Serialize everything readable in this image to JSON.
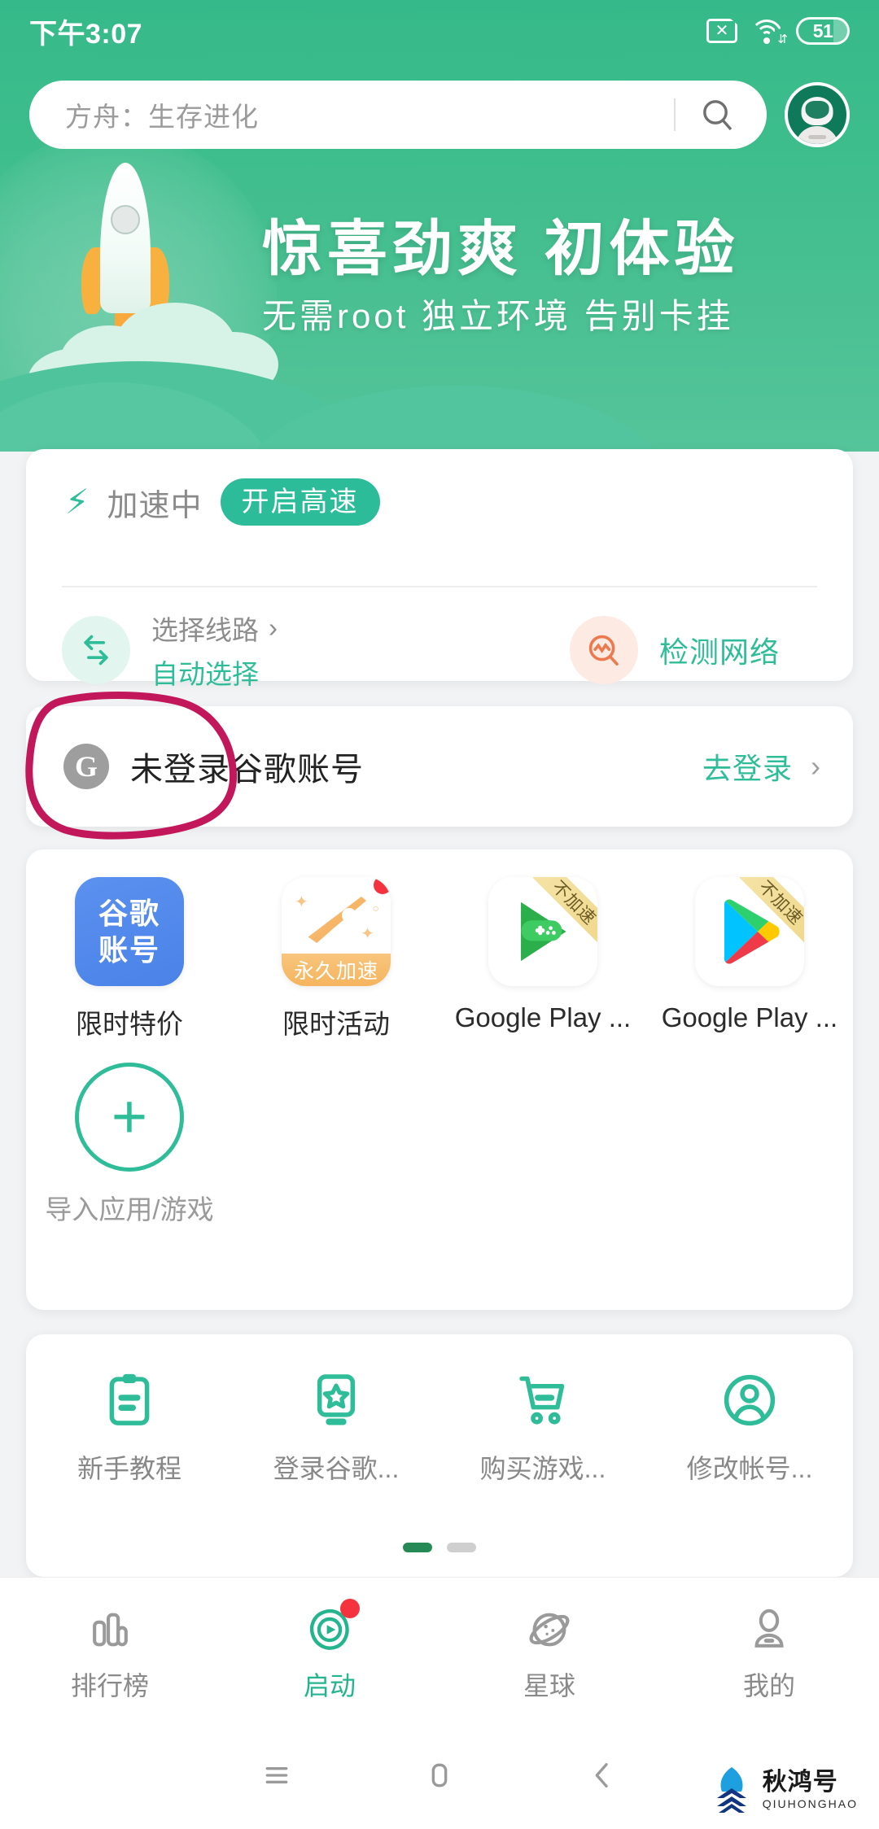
{
  "status_bar": {
    "time": "下午3:07",
    "sim_icon": "sim-card-x-icon",
    "wifi_icon": "wifi-icon",
    "battery_level": "51"
  },
  "search": {
    "placeholder": "方舟：生存进化",
    "search_icon": "search-icon",
    "avatar": "astronaut-avatar"
  },
  "hero": {
    "title": "惊喜劲爽  初体验",
    "subtitle": "无需root  独立环境  告别卡挂",
    "illustration": "rocket-launch-illustration"
  },
  "accelerate_card": {
    "bolt_icon": "lightning-bolt-icon",
    "status_label": "加速中",
    "speed_badge": "开启高速",
    "route": {
      "icon": "swap-arrows-icon",
      "title": "选择线路",
      "chevron": "chevron-right-icon",
      "value": "自动选择"
    },
    "network_check": {
      "icon": "network-pulse-search-icon",
      "label": "检测网络"
    }
  },
  "google_card": {
    "avatar_letter": "G",
    "title": "未登录谷歌账号",
    "action": "去登录",
    "chevron": "chevron-right-icon"
  },
  "apps": [
    {
      "label": "限时特价",
      "icon": "google-account-icon",
      "icon_text_line1": "谷歌",
      "icon_text_line2": "账号",
      "ribbon": "",
      "badge": false
    },
    {
      "label": "限时活动",
      "icon": "rocket-promo-icon",
      "icon_caption": "永久加速",
      "ribbon": "",
      "badge": true
    },
    {
      "label": "Google Play ...",
      "icon": "google-play-games-icon",
      "ribbon": "不加速",
      "badge": false
    },
    {
      "label": "Google Play ...",
      "icon": "google-play-store-icon",
      "ribbon": "不加速",
      "badge": false
    }
  ],
  "import_tile": {
    "icon": "plus-circle-icon",
    "label": "导入应用/游戏"
  },
  "shortcuts": [
    {
      "label": "新手教程",
      "icon": "clipboard-icon"
    },
    {
      "label": "登录谷歌...",
      "icon": "phone-star-icon"
    },
    {
      "label": "购买游戏...",
      "icon": "shopping-cart-icon"
    },
    {
      "label": "修改帐号...",
      "icon": "person-circle-icon"
    }
  ],
  "pager": {
    "total": 2,
    "active_index": 0
  },
  "bottom_nav": [
    {
      "label": "排行榜",
      "icon": "bar-chart-icon",
      "active": false,
      "badge": false
    },
    {
      "label": "启动",
      "icon": "play-leaf-icon",
      "active": true,
      "badge": true
    },
    {
      "label": "星球",
      "icon": "planet-icon",
      "active": false,
      "badge": false
    },
    {
      "label": "我的",
      "icon": "user-icon",
      "active": false,
      "badge": false
    }
  ],
  "system_nav": {
    "recents": "menu-icon",
    "home": "home-square-icon",
    "back": "back-chevron-icon"
  },
  "watermark": {
    "cn": "秋鸿号",
    "en": "QIUHONGHAO"
  },
  "colors": {
    "hero_green": "#3dbd8c",
    "teal": "#2fbd99",
    "accent_dark_green": "#258a55",
    "annotation": "#c2185b",
    "red_badge": "#f5333f",
    "ribbon": "#f0d98d"
  }
}
